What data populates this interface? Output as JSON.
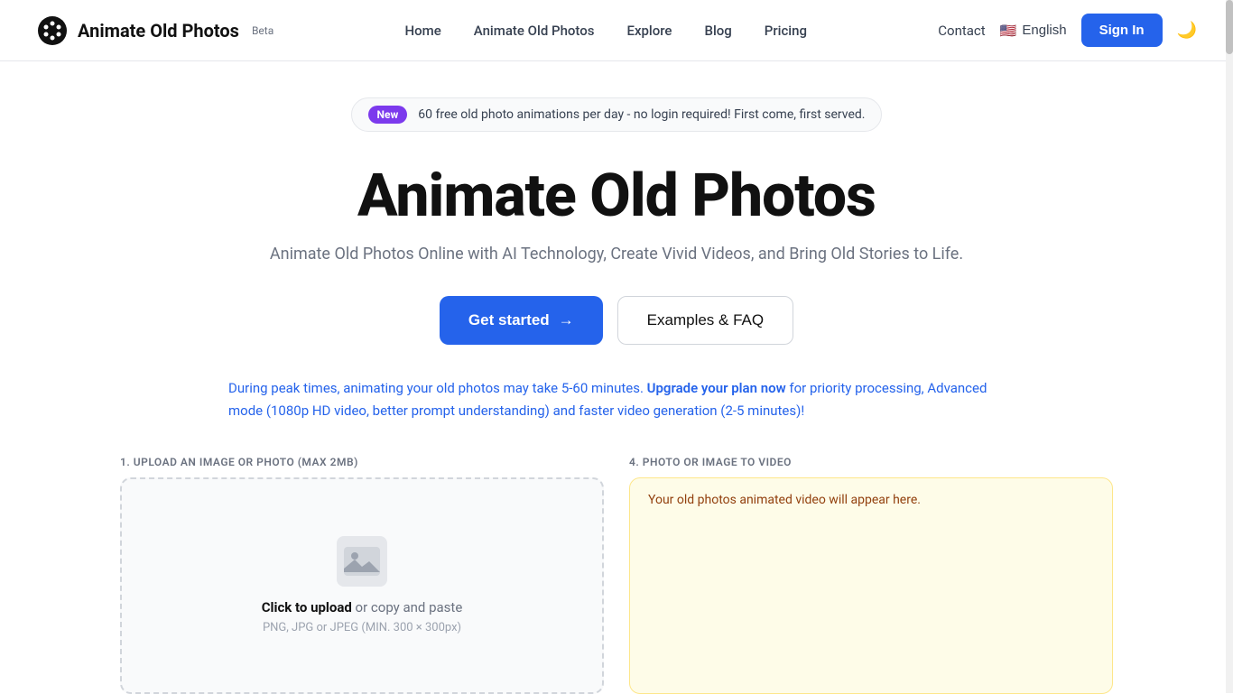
{
  "header": {
    "logo_title": "Animate Old Photos",
    "beta_label": "Beta",
    "nav": [
      {
        "label": "Home",
        "id": "home"
      },
      {
        "label": "Animate Old Photos",
        "id": "animate"
      },
      {
        "label": "Explore",
        "id": "explore"
      },
      {
        "label": "Blog",
        "id": "blog"
      },
      {
        "label": "Pricing",
        "id": "pricing"
      }
    ],
    "contact_label": "Contact",
    "language_label": "English",
    "sign_in_label": "Sign In",
    "dark_mode_icon": "🌙"
  },
  "banner": {
    "new_label": "New",
    "text": "60 free old photo animations per day - no login required! First come, first served."
  },
  "hero": {
    "title": "Animate Old Photos",
    "subtitle": "Animate Old Photos Online with AI Technology, Create Vivid Videos, and Bring Old Stories to Life."
  },
  "cta": {
    "get_started": "Get started",
    "get_started_arrow": "→",
    "examples_faq": "Examples & FAQ"
  },
  "notice": {
    "part1": "During peak times, animating your old photos may take 5-60 minutes. ",
    "link_text": "Upgrade your plan now",
    "part2": " for priority processing, Advanced mode (1080p HD video, better prompt understanding) and faster video generation (2-5 minutes)!"
  },
  "upload_section": {
    "upload_label": "1. UPLOAD AN IMAGE OR PHOTO (MAX 2MB)",
    "video_label": "4. PHOTO OR IMAGE TO VIDEO",
    "upload_click": "Click to upload",
    "upload_or": " or copy and paste",
    "upload_hint": "PNG, JPG or JPEG (MIN. 300 × 300px)",
    "video_placeholder": "Your old photos animated video will appear here."
  }
}
